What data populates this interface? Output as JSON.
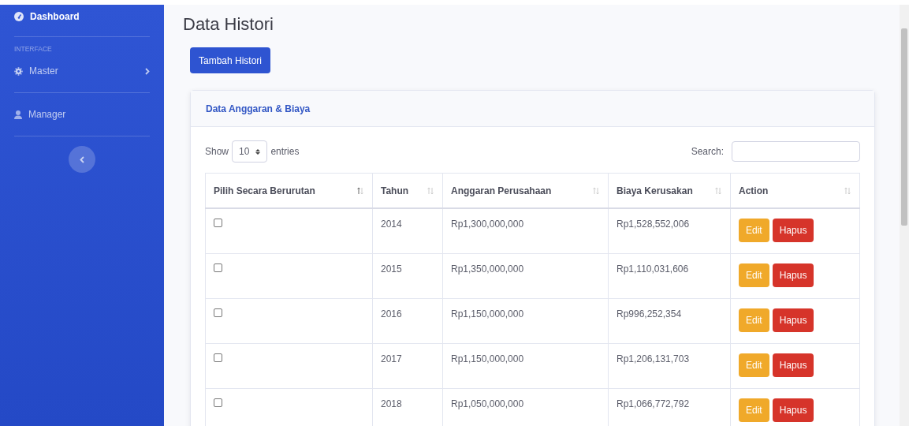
{
  "sidebar": {
    "items": [
      {
        "kind": "link",
        "label": "Dashboard",
        "selected": true
      },
      {
        "kind": "divider"
      },
      {
        "kind": "heading",
        "label": "INTERFACE"
      },
      {
        "kind": "link",
        "label": "Master",
        "selected": false,
        "has_submenu": true
      },
      {
        "kind": "divider"
      },
      {
        "kind": "link",
        "label": "Manager",
        "selected": false
      },
      {
        "kind": "divider"
      },
      {
        "kind": "toggle"
      }
    ]
  },
  "page_title": "Data Histori",
  "add_button": "Tambah Histori",
  "card": {
    "title": "Data Anggaran & Biaya",
    "length": {
      "before": "Show",
      "value": "10",
      "after": "entries"
    },
    "search": {
      "label": "Search:"
    },
    "table": {
      "columns": [
        {
          "label": "Pilih Secara Berurutan",
          "sorted": true
        },
        {
          "label": "Tahun",
          "sorted": false
        },
        {
          "label": "Anggaran Perusahaan",
          "sorted": false
        },
        {
          "label": "Biaya Kerusakan",
          "sorted": false
        },
        {
          "label": "Action",
          "sorted": false
        }
      ],
      "rows": [
        {
          "checked": false,
          "year": "2014",
          "budget": "Rp1,300,000,000",
          "cost": "Rp1,528,552,006",
          "actions": [
            "Edit",
            "Hapus"
          ]
        },
        {
          "checked": false,
          "year": "2015",
          "budget": "Rp1,350,000,000",
          "cost": "Rp1,110,031,606",
          "actions": [
            "Edit",
            "Hapus"
          ]
        },
        {
          "checked": false,
          "year": "2016",
          "budget": "Rp1,150,000,000",
          "cost": "Rp996,252,354",
          "actions": [
            "Edit",
            "Hapus"
          ]
        },
        {
          "checked": false,
          "year": "2017",
          "budget": "Rp1,150,000,000",
          "cost": "Rp1,206,131,703",
          "actions": [
            "Edit",
            "Hapus"
          ]
        },
        {
          "checked": false,
          "year": "2018",
          "budget": "Rp1,050,000,000",
          "cost": "Rp1,066,772,792",
          "actions": [
            "Edit",
            "Hapus"
          ]
        }
      ]
    }
  }
}
